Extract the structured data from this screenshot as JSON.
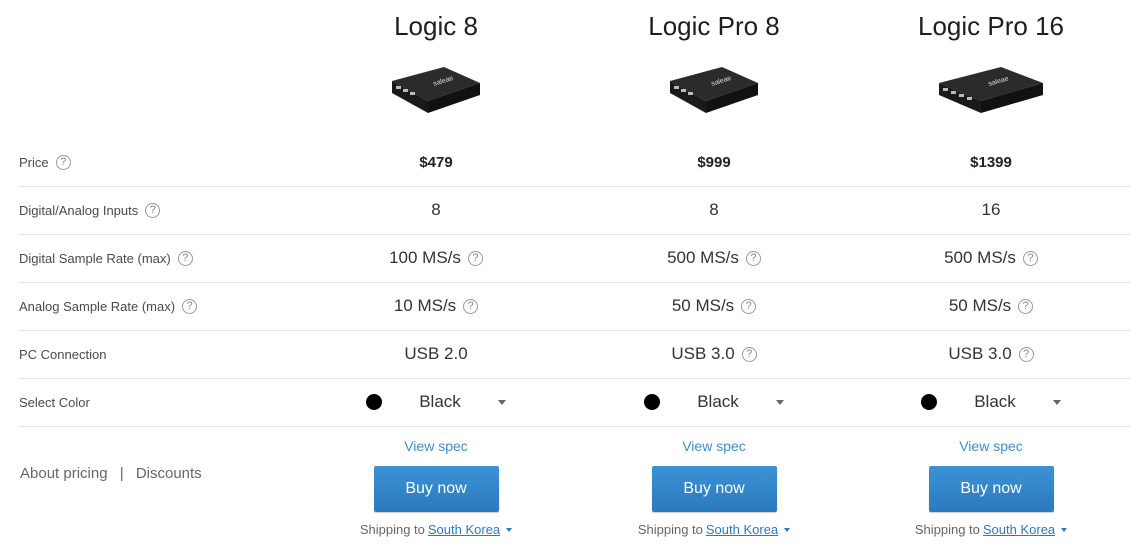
{
  "products": [
    {
      "name": "Logic 8",
      "price": "$479",
      "inputs": "8",
      "digital_rate": "100 MS/s",
      "analog_rate": "10 MS/s",
      "pc_connection": "USB 2.0",
      "color": "Black",
      "view_spec": "View spec",
      "buy": "Buy now",
      "shipping_prefix": "Shipping to",
      "shipping_country": "South Korea"
    },
    {
      "name": "Logic Pro 8",
      "price": "$999",
      "inputs": "8",
      "digital_rate": "500 MS/s",
      "analog_rate": "50 MS/s",
      "pc_connection": "USB 3.0",
      "color": "Black",
      "view_spec": "View spec",
      "buy": "Buy now",
      "shipping_prefix": "Shipping to",
      "shipping_country": "South Korea"
    },
    {
      "name": "Logic Pro 16",
      "price": "$1399",
      "inputs": "16",
      "digital_rate": "500 MS/s",
      "analog_rate": "50 MS/s",
      "pc_connection": "USB 3.0",
      "color": "Black",
      "view_spec": "View spec",
      "buy": "Buy now",
      "shipping_prefix": "Shipping to",
      "shipping_country": "South Korea"
    }
  ],
  "row_labels": {
    "price": "Price",
    "inputs": "Digital/Analog Inputs",
    "digital_rate": "Digital Sample Rate (max)",
    "analog_rate": "Analog Sample Rate (max)",
    "pc_connection": "PC Connection",
    "color": "Select Color"
  },
  "footer": {
    "about_pricing": "About pricing",
    "separator": "|",
    "discounts": "Discounts"
  },
  "device_logo": "saleae",
  "colors": {
    "accent": "#3b8fd1",
    "button": "#2a7ac0",
    "divider": "#e3e3e3",
    "swatch": "#000000"
  }
}
